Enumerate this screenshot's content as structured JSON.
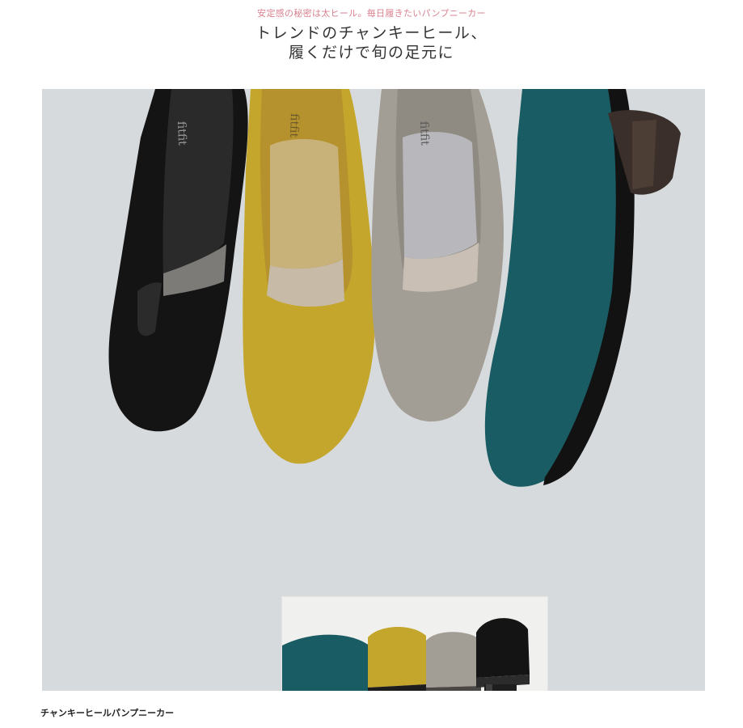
{
  "header": {
    "tagline": "安定感の秘密は太ヒール。毎日履きたいパンプニーカー",
    "headline_line1": "トレンドのチャンキーヒール、",
    "headline_line2": "履くだけで旬の足元に"
  },
  "hero": {
    "background": "#d7dadd",
    "brand_mark": "fitfit",
    "shoe_colors": {
      "black": "#141414",
      "mustard": "#c3a62b",
      "greige": "#a39e95",
      "teal": "#1a5c63"
    }
  },
  "caption": "チャンキーヒールパンプニーカー"
}
